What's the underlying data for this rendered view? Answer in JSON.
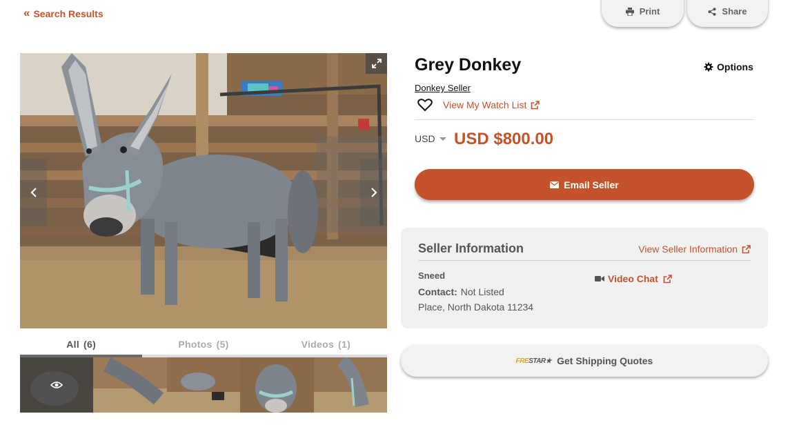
{
  "nav": {
    "back_label": "Search Results"
  },
  "toolbar": {
    "print_label": "Print",
    "share_label": "Share"
  },
  "listing": {
    "title": "Grey Donkey",
    "options_label": "Options",
    "seller_link": "Donkey Seller",
    "watch_list_label": "View My Watch List",
    "currency": "USD",
    "price": "USD $800.00",
    "email_button": "Email Seller"
  },
  "media": {
    "tabs": [
      {
        "label": "All",
        "count": "(6)",
        "active": true
      },
      {
        "label": "Photos",
        "count": "(5)",
        "active": false
      },
      {
        "label": "Videos",
        "count": "(1)",
        "active": false
      }
    ],
    "thumbnail_count": 5
  },
  "seller_info": {
    "heading": "Seller Information",
    "view_link": "View Seller Information",
    "name": "Sneed",
    "contact_label": "Contact:",
    "contact_value": "Not Listed",
    "location": "Place, North Dakota 11234",
    "video_chat": "Video Chat"
  },
  "shipping": {
    "brand_left": "FRE",
    "brand_right": "STAR",
    "label": "Get Shipping Quotes"
  },
  "colors": {
    "accent": "#c4522a",
    "card_bg": "#f1f1f1",
    "button_bg": "#f2f2f2"
  },
  "icons": [
    "double-chevron-left-icon",
    "print-icon",
    "share-icon",
    "expand-icon",
    "chevron-left-icon",
    "chevron-right-icon",
    "eye-icon",
    "gear-icon",
    "heart-icon",
    "external-link-icon",
    "envelope-icon",
    "video-camera-icon",
    "freightstar-logo"
  ]
}
